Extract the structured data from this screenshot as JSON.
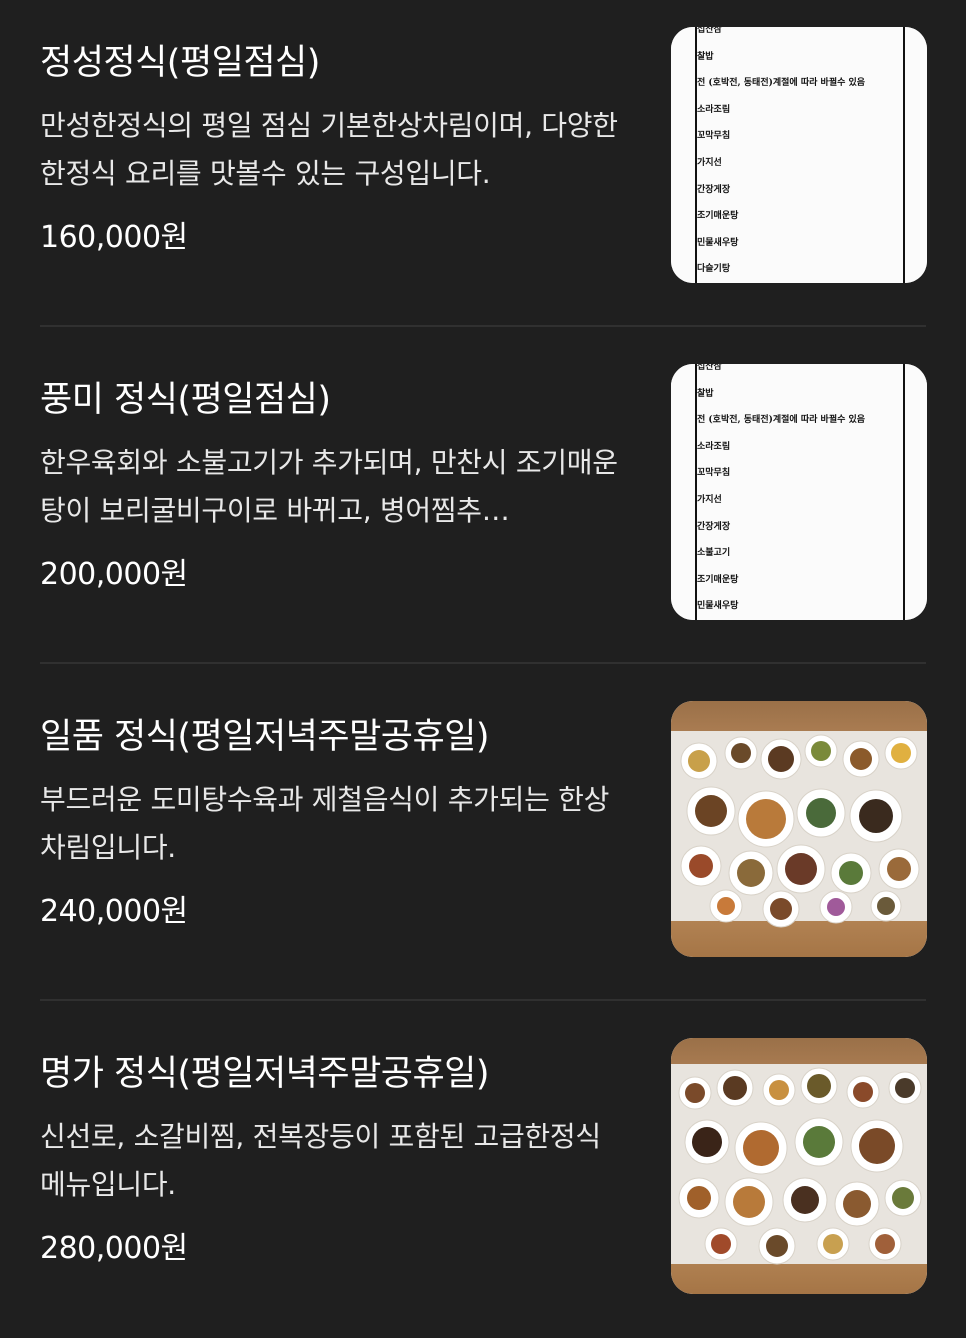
{
  "menu": {
    "items": [
      {
        "name": "정성정식(평일점심)",
        "description": "만성한정식의 평일 점심 기본한상차림이며, 다양한 한정식 요리를 맛볼수 있는 구성입니다.",
        "price": "160,000원",
        "thumbnail_type": "menu-sheet",
        "thumbnail_lines": [
          "섭산삼",
          "찰밥",
          "전 (호박전, 동태전)계절에 따라 바뀔수 있음",
          "소라조림",
          "꼬막무침",
          "가지선",
          "간장게장",
          "조기매운탕",
          "민물새우탕",
          "다슬기탕"
        ]
      },
      {
        "name": "풍미 정식(평일점심)",
        "description": "한우육회와 소불고기가 추가되며, 만찬시 조기매운탕이 보리굴비구이로 바뀌고, 병어찜추…",
        "price": "200,000원",
        "thumbnail_type": "menu-sheet",
        "thumbnail_lines": [
          "섭산삼",
          "찰밥",
          "전 (호박전, 동태전)계절에 따라 바뀔수 있음",
          "소라조림",
          "꼬막무침",
          "가지선",
          "간장게장",
          "소불고기",
          "조기매운탕",
          "민물새우탕"
        ]
      },
      {
        "name": "일품 정식(평일저녁주말공휴일)",
        "description": "부드러운 도미탕수육과 제철음식이 추가되는 한상차림입니다.",
        "price": "240,000원",
        "thumbnail_type": "food-photo"
      },
      {
        "name": "명가 정식(평일저녁주말공휴일)",
        "description": "신선로, 소갈비찜, 전복장등이 포함된 고급한정식 메뉴입니다.",
        "price": "280,000원",
        "thumbnail_type": "food-photo"
      }
    ]
  },
  "colors": {
    "background": "#1f1f1f",
    "text": "#ffffff",
    "divider": "#303030"
  }
}
